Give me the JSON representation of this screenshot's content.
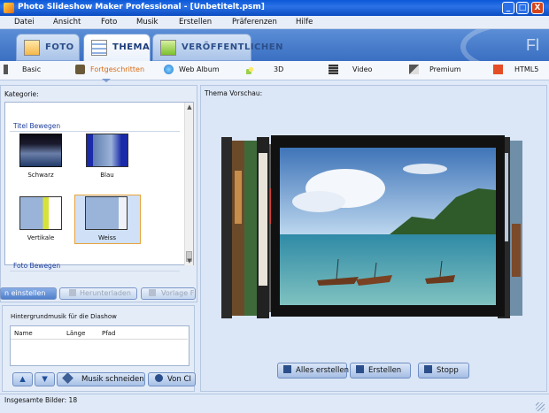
{
  "window": {
    "title": "Photo Slideshow Maker Professional - [Unbetitelt.psm]",
    "controls": {
      "minimize": "_",
      "maximize": "□",
      "close": "X"
    }
  },
  "menu": [
    "Datei",
    "Ansicht",
    "Foto",
    "Musik",
    "Erstellen",
    "Präferenzen",
    "Hilfe"
  ],
  "main_tabs": [
    {
      "label": "FOTO",
      "icon": "photo-tab-icon",
      "active": false
    },
    {
      "label": "THEMA",
      "icon": "theme-tab-icon",
      "active": true
    },
    {
      "label": "VERÖFFENTLICHEN",
      "icon": "publish-tab-icon",
      "active": false
    }
  ],
  "brand_text": "Fl",
  "sub_tabs": [
    {
      "label": "Basic",
      "icon": "basic-icon",
      "active": false
    },
    {
      "label": "Fortgeschritten",
      "icon": "advanced-icon",
      "active": true
    },
    {
      "label": "Web Album",
      "icon": "web-album-icon",
      "active": false
    },
    {
      "label": "3D",
      "icon": "3d-icon",
      "active": false
    },
    {
      "label": "Video",
      "icon": "video-icon",
      "active": false
    },
    {
      "label": "Premium",
      "icon": "premium-icon",
      "active": false
    },
    {
      "label": "HTML5",
      "icon": "html5-icon",
      "active": false
    }
  ],
  "category": {
    "label": "Kategorie:",
    "sections": [
      {
        "title": "Titel Bewegen",
        "items": [
          {
            "caption": "Schwarz",
            "selected": false
          },
          {
            "caption": "Blau",
            "selected": false
          },
          {
            "caption": "Vertikale",
            "selected": false
          },
          {
            "caption": "Weiss",
            "selected": true
          }
        ]
      },
      {
        "title": "Foto Bewegen",
        "items": []
      }
    ]
  },
  "theme_buttons": {
    "apply": "n einstellen",
    "download": "Herunterladen",
    "template": "Vorlage F"
  },
  "music": {
    "label": "Hintergrundmusik für die Diashow",
    "columns": [
      "Name",
      "Länge",
      "Pfad"
    ],
    "rows": [],
    "buttons": {
      "up": "▲",
      "down": "▼",
      "cut": "Musik schneiden",
      "from_cd": "Von CI"
    }
  },
  "preview": {
    "label": "Thema Vorschau:",
    "buttons": {
      "create_all": "Alles erstellen",
      "create": "Erstellen",
      "stop": "Stopp"
    }
  },
  "status": {
    "text": "Insgesamte Bilder: 18"
  },
  "colors": {
    "titlebar": "#0a58d8",
    "active_subtab": "#d86a10",
    "section_heading": "#1c3d9a",
    "selection_border": "#e8a33c"
  }
}
